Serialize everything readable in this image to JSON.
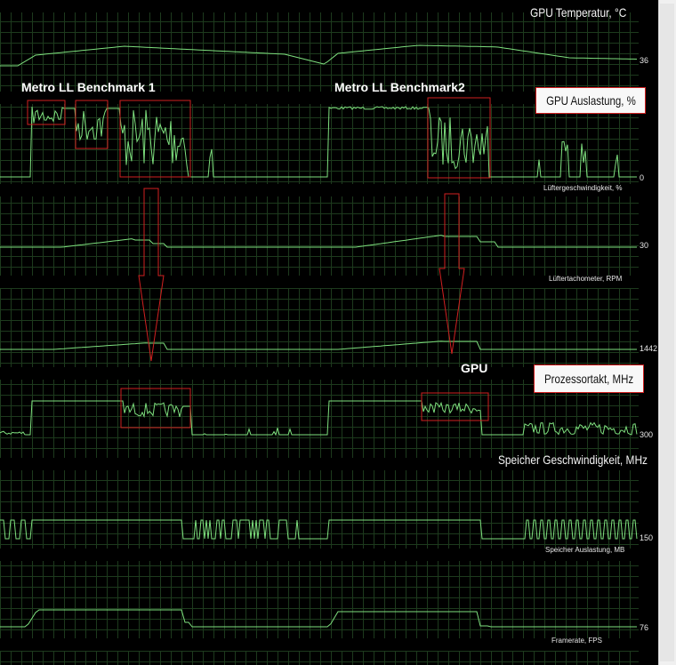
{
  "panels": [
    {
      "title": "GPU Temperatur, °C",
      "value": "36",
      "style": "big"
    },
    {
      "title": "GPU Auslastung, %",
      "value": "0",
      "style": "boxed"
    },
    {
      "title": "Lüftergeschwindigkeit, %",
      "value": "30",
      "style": "small"
    },
    {
      "title": "Lüftertachometer, RPM",
      "value": "1442",
      "style": "small"
    },
    {
      "title": "Prozessortakt, MHz",
      "value": "300",
      "style": "boxed"
    },
    {
      "title": "Speicher Geschwindigkeit, MHz",
      "value": "150",
      "style": "big"
    },
    {
      "title": "Speicher Auslastung, MB",
      "value": "76",
      "style": "small"
    },
    {
      "title": "Framerate, FPS",
      "value": "",
      "style": "small"
    }
  ],
  "annotations": {
    "benchmark1": "Metro LL Benchmark 1",
    "benchmark2": "Metro LL Benchmark2",
    "gpu": "GPU"
  },
  "colors": {
    "line": "#7ee07e",
    "grid": "#1d3a1d",
    "highlight": "#d02020",
    "background": "#000000"
  }
}
